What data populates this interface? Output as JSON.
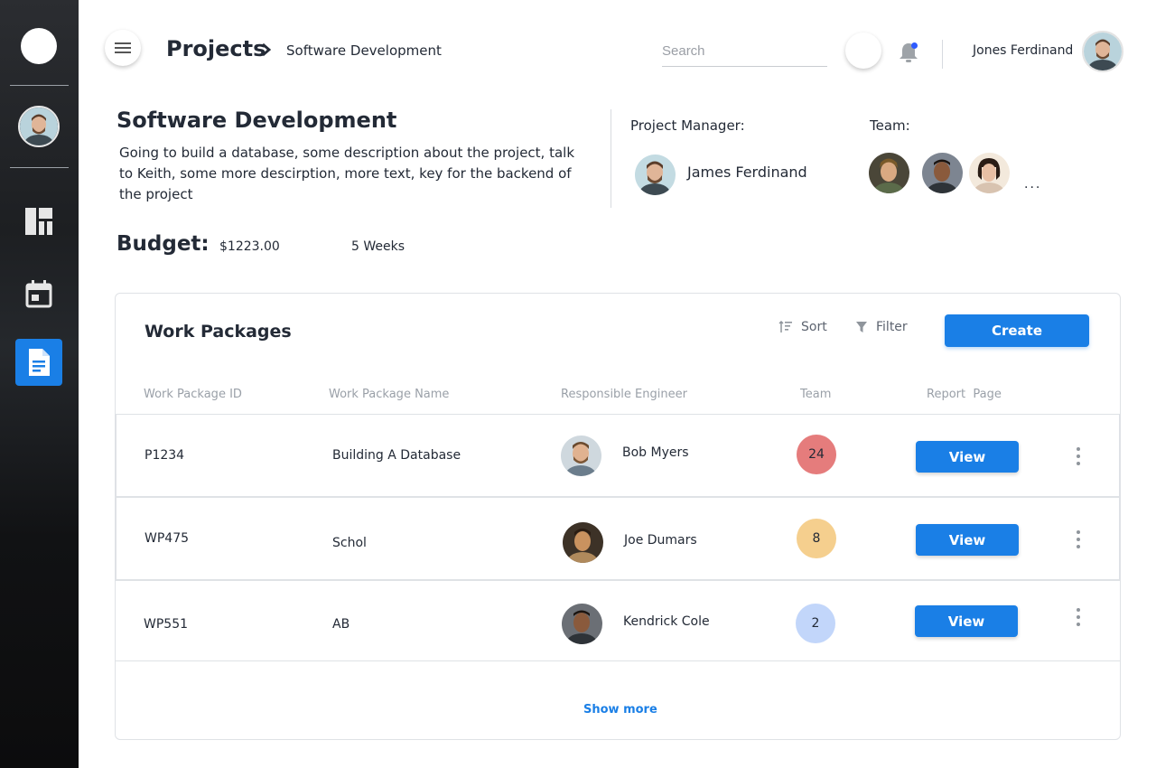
{
  "sidebar": {
    "items": [
      {
        "icon": "dashboard-icon"
      },
      {
        "icon": "calendar-icon"
      },
      {
        "icon": "document-icon",
        "active": true
      }
    ]
  },
  "header": {
    "breadcrumb_root": "Projects",
    "breadcrumb_current": "Software Development",
    "search_placeholder": "Search",
    "user_name": "Jones Ferdinand"
  },
  "project": {
    "title": "Software Development",
    "description": "Going to build a database, some description about the project, talk to Keith, some more descirption, more text, key for the backend of the project",
    "manager_label": "Project Manager:",
    "manager_name": "James Ferdinand",
    "team_label": "Team:",
    "team_more": "...",
    "budget_label": "Budget:",
    "budget_value": "$1223.00",
    "duration": "5 Weeks"
  },
  "work_packages": {
    "title": "Work Packages",
    "sort_label": "Sort",
    "filter_label": "Filter",
    "create_label": "Create",
    "columns": [
      "Work Package ID",
      "Work Package Name",
      "Responsible Engineer",
      "Team",
      "Report  Page"
    ],
    "rows": [
      {
        "id": "P1234",
        "name": "Building A Database",
        "engineer": "Bob Myers",
        "team": "24",
        "team_color": "#e57c7c",
        "action": "View"
      },
      {
        "id": "WP475",
        "name": "Schol",
        "engineer": "Joe Dumars",
        "team": "8",
        "team_color": "#f5cf8e",
        "action": "View"
      },
      {
        "id": "WP551",
        "name": "AB",
        "engineer": "Kendrick Cole",
        "team": "2",
        "team_color": "#c2d6fa",
        "action": "View"
      }
    ],
    "show_more": "Show more"
  },
  "colors": {
    "accent": "#1a7fe6",
    "notification_dot": "#2e5bff"
  }
}
